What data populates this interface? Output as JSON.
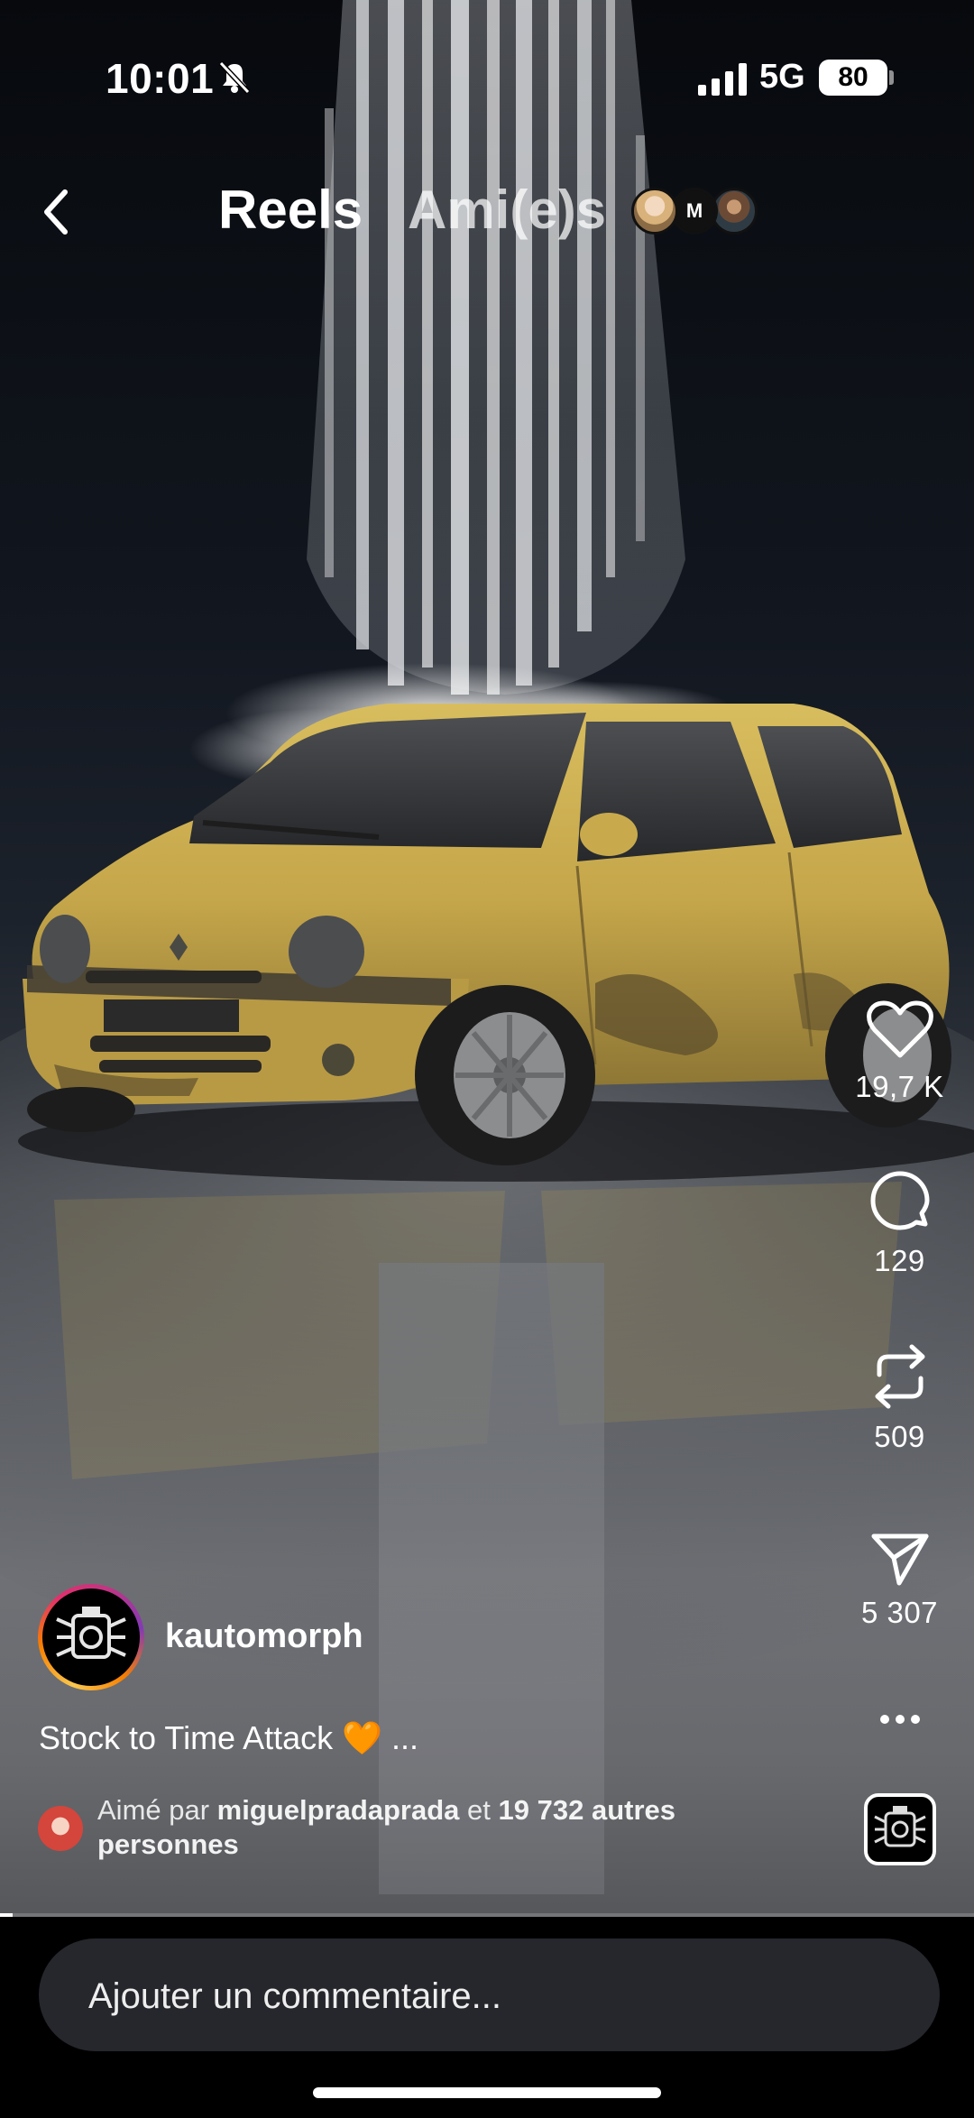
{
  "status_bar": {
    "time": "10:01",
    "network": "5G",
    "battery": "80",
    "icons": [
      "bell-slash-icon",
      "signal-icon"
    ]
  },
  "header": {
    "back_icon": "chevron-left-icon",
    "tabs": [
      "Reels",
      "Ami(e)s"
    ],
    "active_tab": "Reels",
    "friend_avatar_text": "M"
  },
  "actions": {
    "likes": "19,7 K",
    "comments": "129",
    "reposts": "509",
    "shares": "5 307",
    "icons": [
      "heart-icon",
      "comment-icon",
      "repost-icon",
      "send-icon",
      "more-icon"
    ]
  },
  "post": {
    "username": "kautomorph",
    "caption": "Stock to Time Attack",
    "caption_emoji": "🧡",
    "caption_more": "...",
    "liked_prefix": "Aimé par",
    "liked_user": "miguelpradaprada",
    "liked_connector": "et",
    "liked_others": "19 732 autres personnes"
  },
  "comment": {
    "placeholder": "Ajouter un commentaire..."
  },
  "colors": {
    "background": "#000000",
    "comment_box": "#26272c",
    "car_yellow": "#c9a94a",
    "caption_heart": "#f6a23a"
  }
}
